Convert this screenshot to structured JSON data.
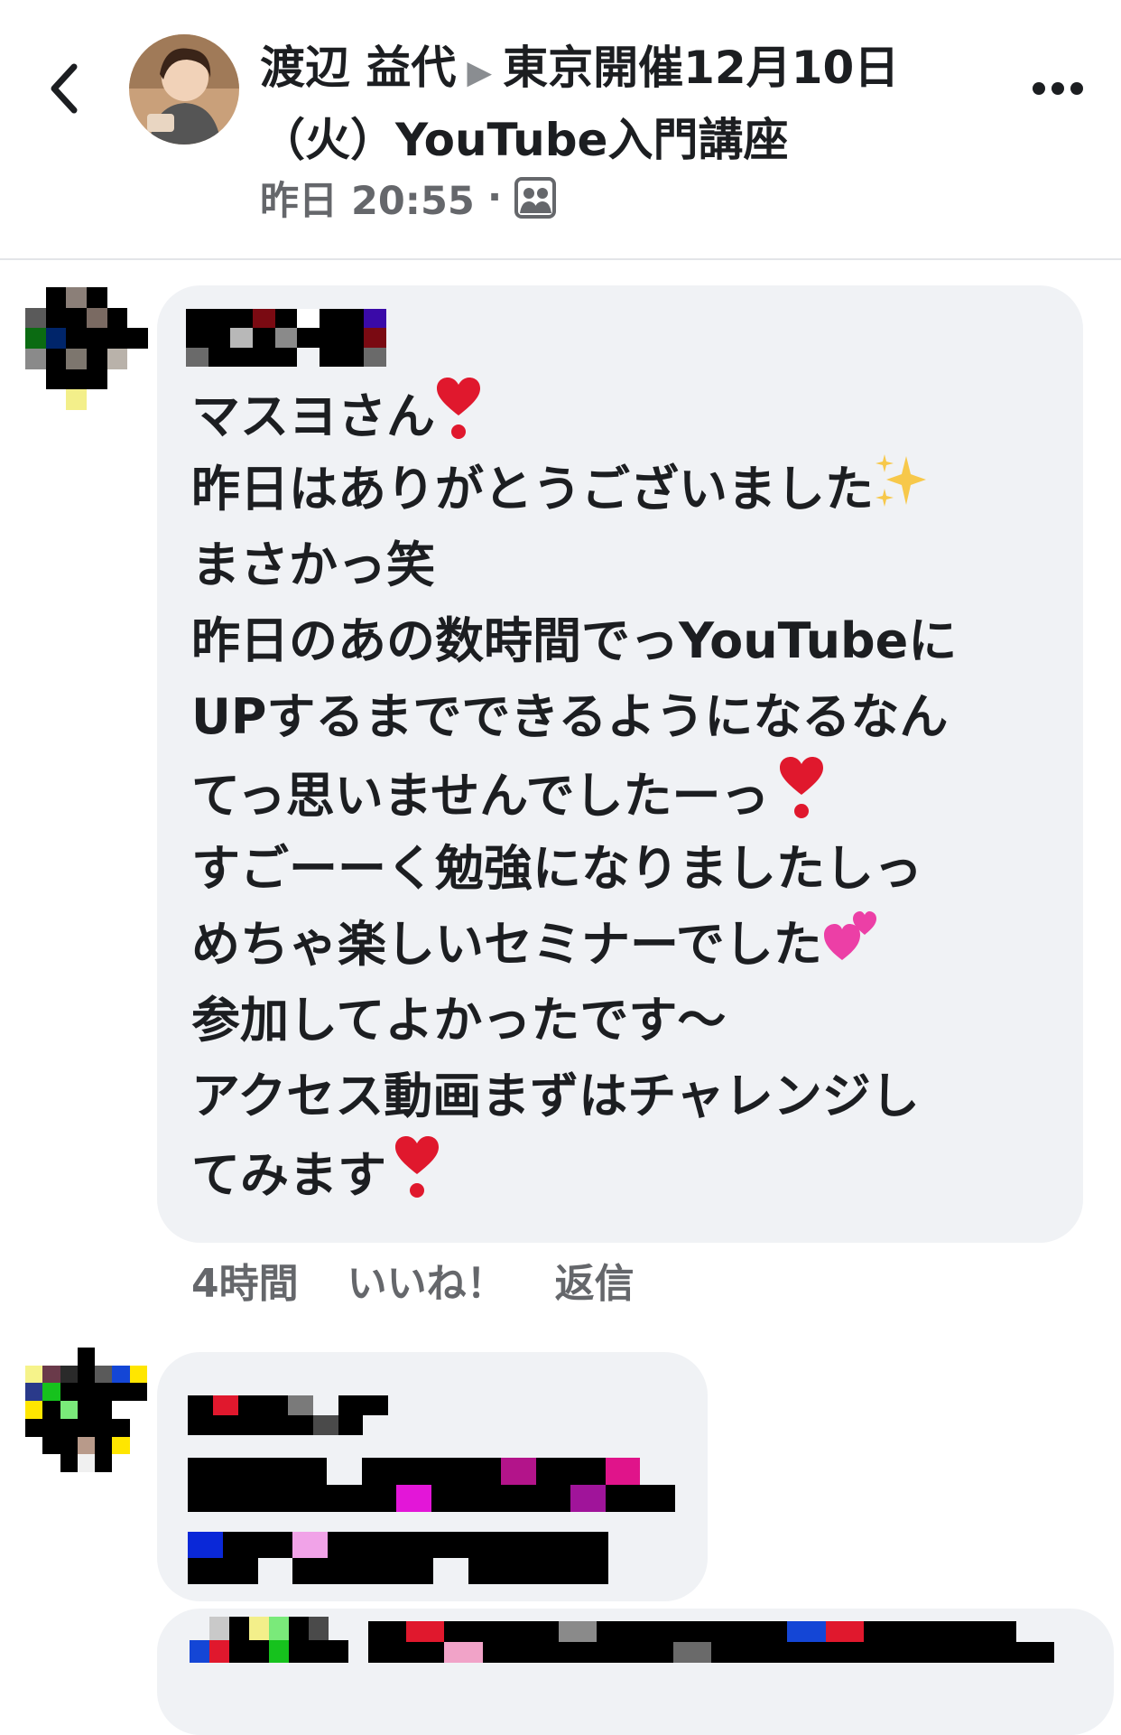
{
  "header": {
    "author": "渡辺 益代",
    "arrow": "▶",
    "group_title_line1": "東京開催12月10日",
    "group_title_line2": "（火）YouTube入門講座",
    "time": "昨日 20:55",
    "dot": "·",
    "privacy_icon": "group-icon",
    "back_icon": "chevron-left-icon",
    "more_icon": "more-dots-icon"
  },
  "comments": [
    {
      "message_lines": [
        "マスヨさん",
        "昨日はありがとうございました",
        "まさかっ笑",
        "昨日のあの数時間でっYouTubeに",
        "UPするまでできるようになるなん",
        "てっ思いませんでしたーっ",
        "すごーーく勉強になりましたしっ",
        "めちゃ楽しいセミナーでした",
        "参加してよかったです～",
        "アクセス動画まずはチャレンジし",
        "てみます"
      ],
      "emojis": {
        "heart": "❤️",
        "sparkles": "✨",
        "two_hearts": "💕"
      },
      "time": "4時間",
      "like_label": "いいね！",
      "reply_label": "返信"
    }
  ],
  "colors": {
    "bubble": "#f0f2f5",
    "secondary_text": "#65676b",
    "primary_text": "#1c1e21",
    "divider": "#e3e5e8",
    "heart": "#e0182d"
  }
}
